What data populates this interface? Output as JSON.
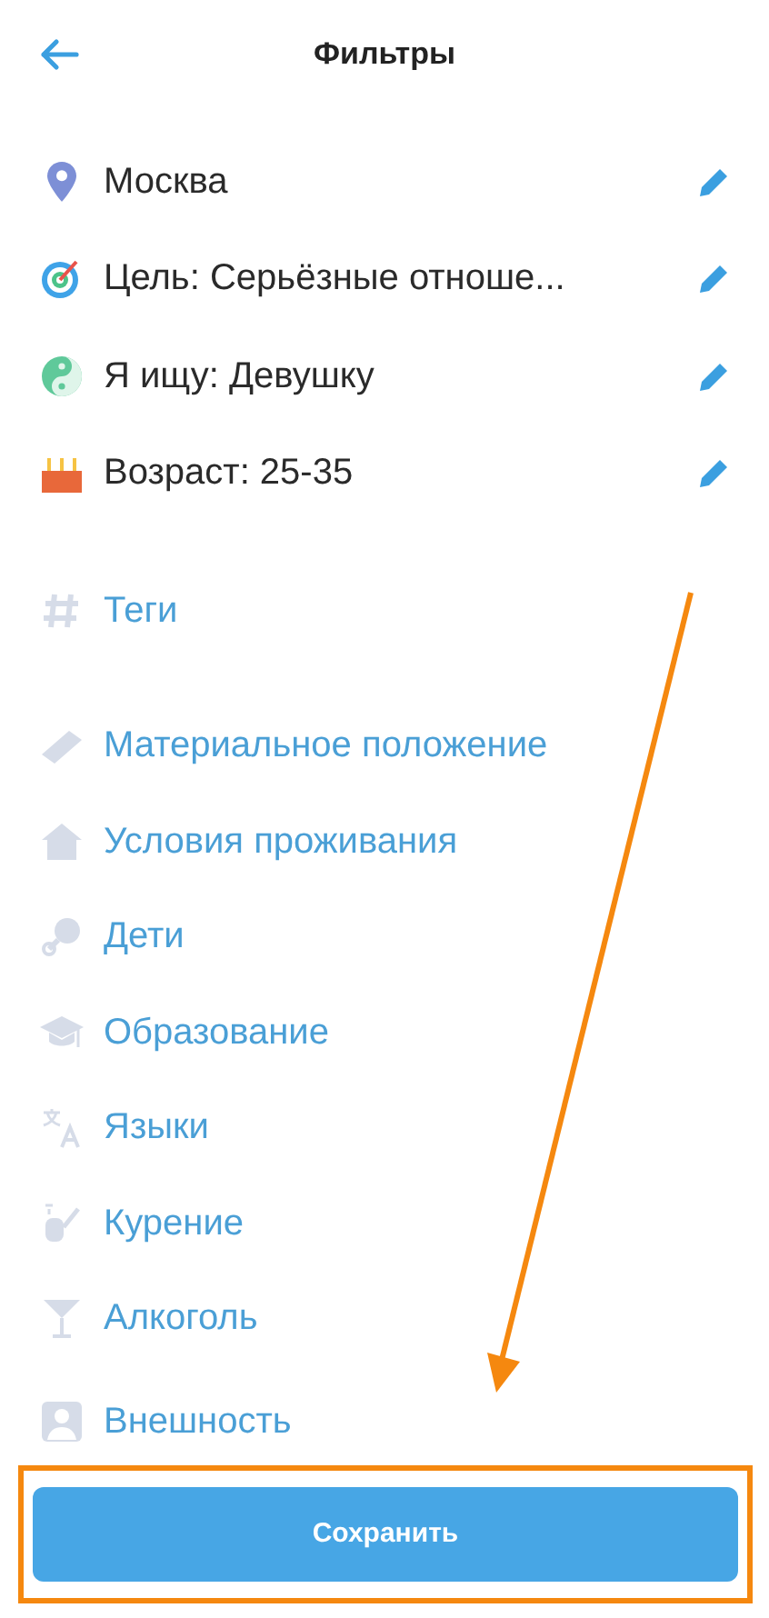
{
  "header": {
    "title": "Фильтры"
  },
  "filters": [
    {
      "kind": "set",
      "label": "Москва"
    },
    {
      "kind": "set",
      "label": "Цель: Серьёзные отноше..."
    },
    {
      "kind": "set",
      "label": "Я ищу: Девушку"
    },
    {
      "kind": "set",
      "label": "Возраст: 25-35"
    }
  ],
  "tags": {
    "label": "Теги"
  },
  "options": [
    {
      "kind": "unset",
      "label": "Материальное положение"
    },
    {
      "kind": "unset",
      "label": "Условия проживания"
    },
    {
      "kind": "unset",
      "label": "Дети"
    },
    {
      "kind": "unset",
      "label": "Образование"
    },
    {
      "kind": "unset",
      "label": "Языки"
    },
    {
      "kind": "unset",
      "label": "Курение"
    },
    {
      "kind": "unset",
      "label": "Алкоголь"
    },
    {
      "kind": "unset",
      "label": "Внешность"
    }
  ],
  "save_button": {
    "label": "Сохранить"
  }
}
